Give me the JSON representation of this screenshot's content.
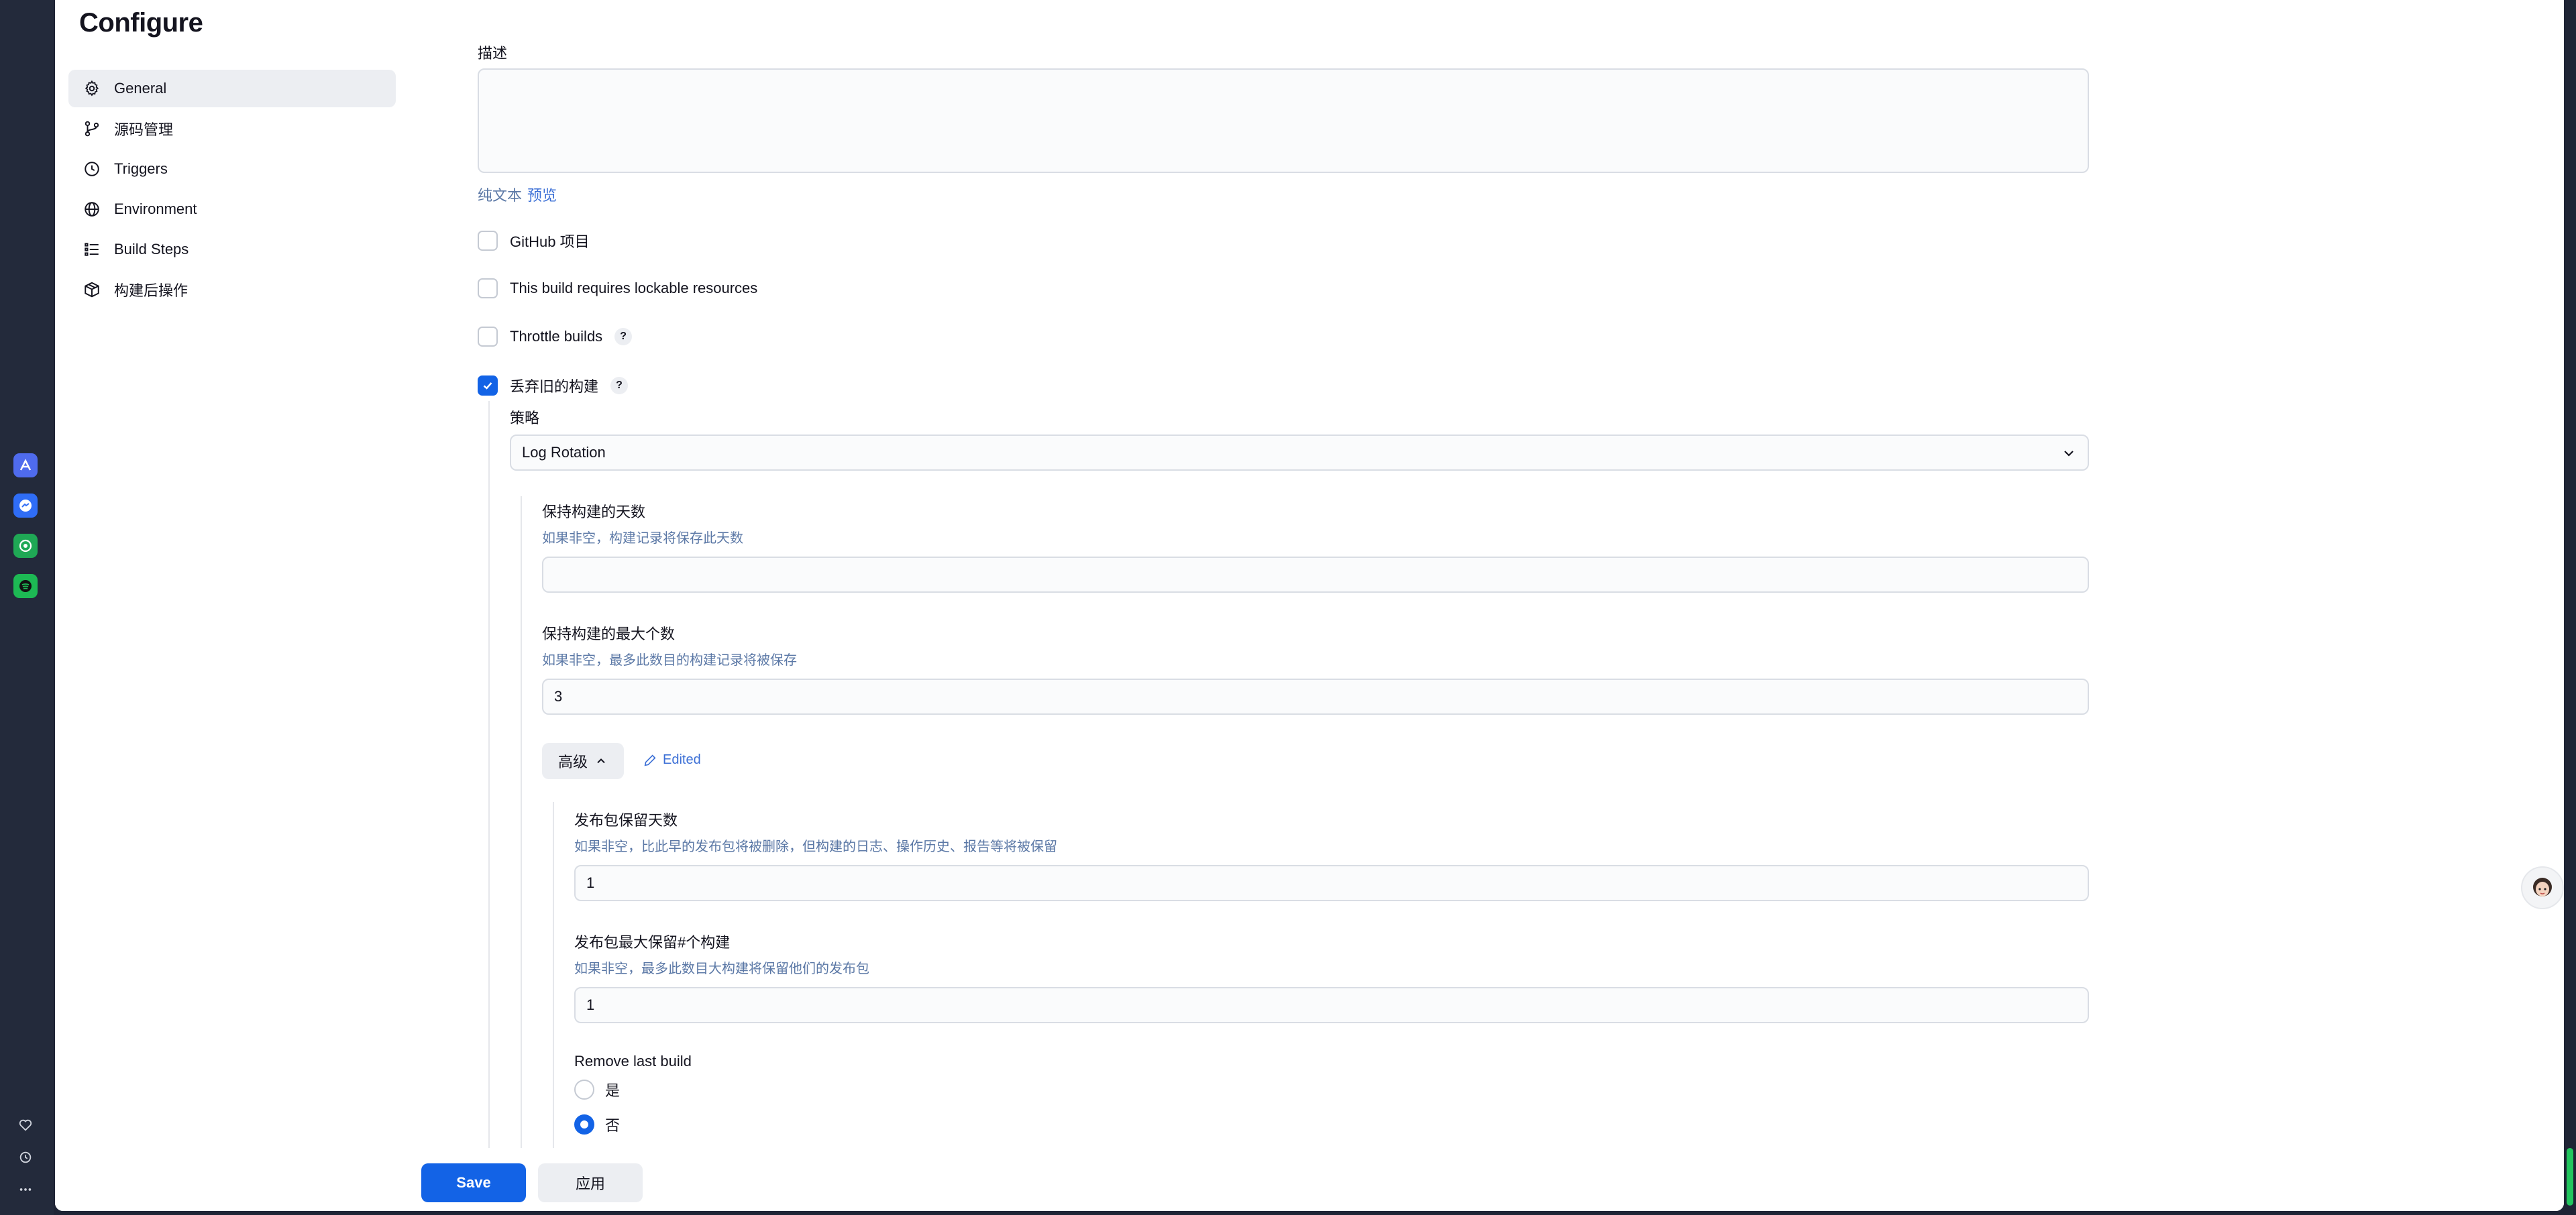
{
  "page": {
    "title": "Configure"
  },
  "sidebar": {
    "items": [
      {
        "label": "General",
        "icon": "gear-icon",
        "active": true
      },
      {
        "label": "源码管理",
        "icon": "branch-icon"
      },
      {
        "label": "Triggers",
        "icon": "clock-icon"
      },
      {
        "label": "Environment",
        "icon": "globe-icon"
      },
      {
        "label": "Build Steps",
        "icon": "list-icon"
      },
      {
        "label": "构建后操作",
        "icon": "package-icon"
      }
    ]
  },
  "description": {
    "label": "描述",
    "value": "",
    "plain_text_link": "纯文本",
    "preview_link": "预览"
  },
  "options": {
    "github_project": {
      "label": "GitHub 项目",
      "checked": false
    },
    "lockable_resources": {
      "label": "This build requires lockable resources",
      "checked": false
    },
    "throttle_builds": {
      "label": "Throttle builds",
      "checked": false,
      "help": "?"
    },
    "discard_old_builds": {
      "label": "丢弃旧的构建",
      "checked": true,
      "help": "?"
    }
  },
  "strategy": {
    "label": "策略",
    "selected": "Log Rotation"
  },
  "days_to_keep": {
    "label": "保持构建的天数",
    "hint": "如果非空，构建记录将保存此天数",
    "value": ""
  },
  "max_builds": {
    "label": "保持构建的最大个数",
    "hint": "如果非空，最多此数目的构建记录将被保存",
    "value": "3"
  },
  "advanced": {
    "button_label": "高级",
    "edited_label": "Edited"
  },
  "artifact_days": {
    "label": "发布包保留天数",
    "hint": "如果非空，比此早的发布包将被删除，但构建的日志、操作历史、报告等将被保留",
    "value": "1"
  },
  "artifact_max": {
    "label": "发布包最大保留#个构建",
    "hint": "如果非空，最多此数目大构建将保留他们的发布包",
    "value": "1"
  },
  "remove_last_build": {
    "label": "Remove last build",
    "options": [
      {
        "label": "是",
        "selected": false
      },
      {
        "label": "否",
        "selected": true
      }
    ]
  },
  "actions": {
    "save": "Save",
    "apply": "应用"
  },
  "colors": {
    "accent": "#1363e6",
    "hint": "#5b78a6",
    "success": "#22c55e"
  }
}
